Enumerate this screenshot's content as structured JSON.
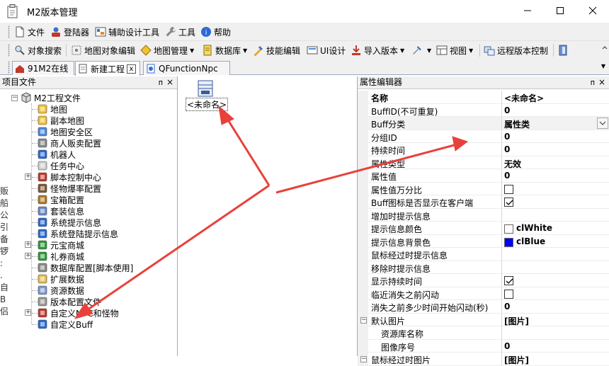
{
  "window": {
    "title": "M2版本管理"
  },
  "menu": [
    {
      "label": "文件",
      "icon": "document-icon"
    },
    {
      "label": "登陆器",
      "icon": "user-icon"
    },
    {
      "label": "辅助设计工具",
      "icon": "design-tool-icon"
    },
    {
      "label": "工具",
      "icon": "wrench-icon"
    },
    {
      "label": "帮助",
      "icon": "help-icon"
    }
  ],
  "toolbar": [
    {
      "label": "对象搜索",
      "icon": "object-search-icon"
    },
    {
      "label": "地图对象编辑",
      "icon": "map-edit-icon"
    },
    {
      "label": "地图管理",
      "icon": "map-manage-icon",
      "dropdown": true
    },
    {
      "label": "数据库",
      "icon": "database-icon",
      "dropdown": true
    },
    {
      "label": "技能编辑",
      "icon": "skill-edit-icon"
    },
    {
      "label": "UI设计",
      "icon": "ui-design-icon"
    },
    {
      "label": "导入版本",
      "icon": "import-version-icon",
      "dropdown": true
    },
    {
      "label": "",
      "icon": "tools-icon",
      "dropdown": true
    },
    {
      "label": "视图",
      "icon": "view-icon",
      "dropdown": true
    },
    {
      "label": "远程版本控制",
      "icon": "remote-version-icon"
    },
    {
      "label": "",
      "icon": "exit-icon"
    }
  ],
  "tabs": [
    {
      "label": "91M2在线"
    },
    {
      "label": "新建工程",
      "close": "x"
    },
    {
      "label": "QFunctionNpc"
    }
  ],
  "left_panel": {
    "title": "项目文件",
    "pin": "ᴨ",
    "close": "×",
    "root": "M2工程文件",
    "items": [
      {
        "label": "地图",
        "icon": "map-icon",
        "expandable": false
      },
      {
        "label": "副本地图",
        "icon": "map-icon",
        "expandable": false
      },
      {
        "label": "地图安全区",
        "icon": "safe-zone-icon",
        "expandable": false
      },
      {
        "label": "商人贩卖配置",
        "icon": "merchant-icon",
        "expandable": false
      },
      {
        "label": "机器人",
        "icon": "robot-icon",
        "expandable": false
      },
      {
        "label": "任务中心",
        "icon": "task-icon",
        "expandable": false
      },
      {
        "label": "脚本控制中心",
        "icon": "script-icon",
        "expandable": true
      },
      {
        "label": "怪物爆率配置",
        "icon": "monster-drop-icon",
        "expandable": false
      },
      {
        "label": "宝箱配置",
        "icon": "treasure-icon",
        "expandable": false
      },
      {
        "label": "套装信息",
        "icon": "shield-icon",
        "expandable": false
      },
      {
        "label": "系统提示信息",
        "icon": "info-icon",
        "expandable": false
      },
      {
        "label": "系统登陆提示信息",
        "icon": "info-icon",
        "expandable": false
      },
      {
        "label": "元宝商城",
        "icon": "shop-icon",
        "expandable": true
      },
      {
        "label": "礼券商城",
        "icon": "dollar-icon",
        "expandable": true
      },
      {
        "label": "数据库配置[脚本使用]",
        "icon": "db-config-icon",
        "expandable": false
      },
      {
        "label": "扩展数据",
        "icon": "document-icon",
        "expandable": false
      },
      {
        "label": "资源数据",
        "icon": "resource-icon",
        "expandable": false
      },
      {
        "label": "版本配置文件",
        "icon": "config-file-icon",
        "expandable": false
      },
      {
        "label": "自定义NPC和怪物",
        "icon": "npc-icon",
        "expandable": true
      },
      {
        "label": "自定义Buff",
        "icon": "buff-icon",
        "expandable": false
      }
    ]
  },
  "canvas": {
    "object_label": "<未命名>"
  },
  "right_panel": {
    "title": "属性编辑器",
    "pin": "ᴨ",
    "close": "×",
    "rows": [
      {
        "name": "名称",
        "value": "<未命名>",
        "type": "text",
        "bold_name": true
      },
      {
        "name": "BuffID(不可重复)",
        "value": "0",
        "type": "text"
      },
      {
        "name": "Buff分类",
        "value": "属性类",
        "type": "dropdown"
      },
      {
        "name": "分组ID",
        "value": "0",
        "type": "text"
      },
      {
        "name": "持续时间",
        "value": "0",
        "type": "text"
      },
      {
        "name": "属性类型",
        "value": "无效",
        "type": "text"
      },
      {
        "name": "属性值",
        "value": "0",
        "type": "text"
      },
      {
        "name": "属性值万分比",
        "value": "",
        "type": "checkbox",
        "checked": false
      },
      {
        "name": "Buff图标是否显示在客户端",
        "value": "",
        "type": "checkbox",
        "checked": true
      },
      {
        "name": "增加时提示信息",
        "value": "",
        "type": "text"
      },
      {
        "name": "提示信息颜色",
        "value": "clWhite",
        "type": "color",
        "color": "#ffffff"
      },
      {
        "name": "提示信息背景色",
        "value": "clBlue",
        "type": "color",
        "color": "#0000ff"
      },
      {
        "name": "鼠标经过时提示信息",
        "value": "",
        "type": "text"
      },
      {
        "name": "移除时提示信息",
        "value": "",
        "type": "text"
      },
      {
        "name": "显示持续时间",
        "value": "",
        "type": "checkbox",
        "checked": true
      },
      {
        "name": "临近消失之前闪动",
        "value": "",
        "type": "checkbox",
        "checked": false
      },
      {
        "name": "消失之前多少时间开始闪动(秒)",
        "value": "0",
        "type": "text"
      },
      {
        "name": "默认图片",
        "value": "[图片]",
        "type": "group"
      },
      {
        "name": "资源库名称",
        "value": "",
        "type": "subtext"
      },
      {
        "name": "图像序号",
        "value": "0",
        "type": "subtext"
      },
      {
        "name": "鼠标经过时图片",
        "value": "[图片]",
        "type": "group"
      }
    ]
  },
  "side_text": "贩\n船\n公\n引\n备\n锣\n:\n.\n自\nB\n侣",
  "colors": {
    "arrow": "#e8413a",
    "accent_blue": "#0000ff",
    "tab_border": "#9aa7bd"
  }
}
